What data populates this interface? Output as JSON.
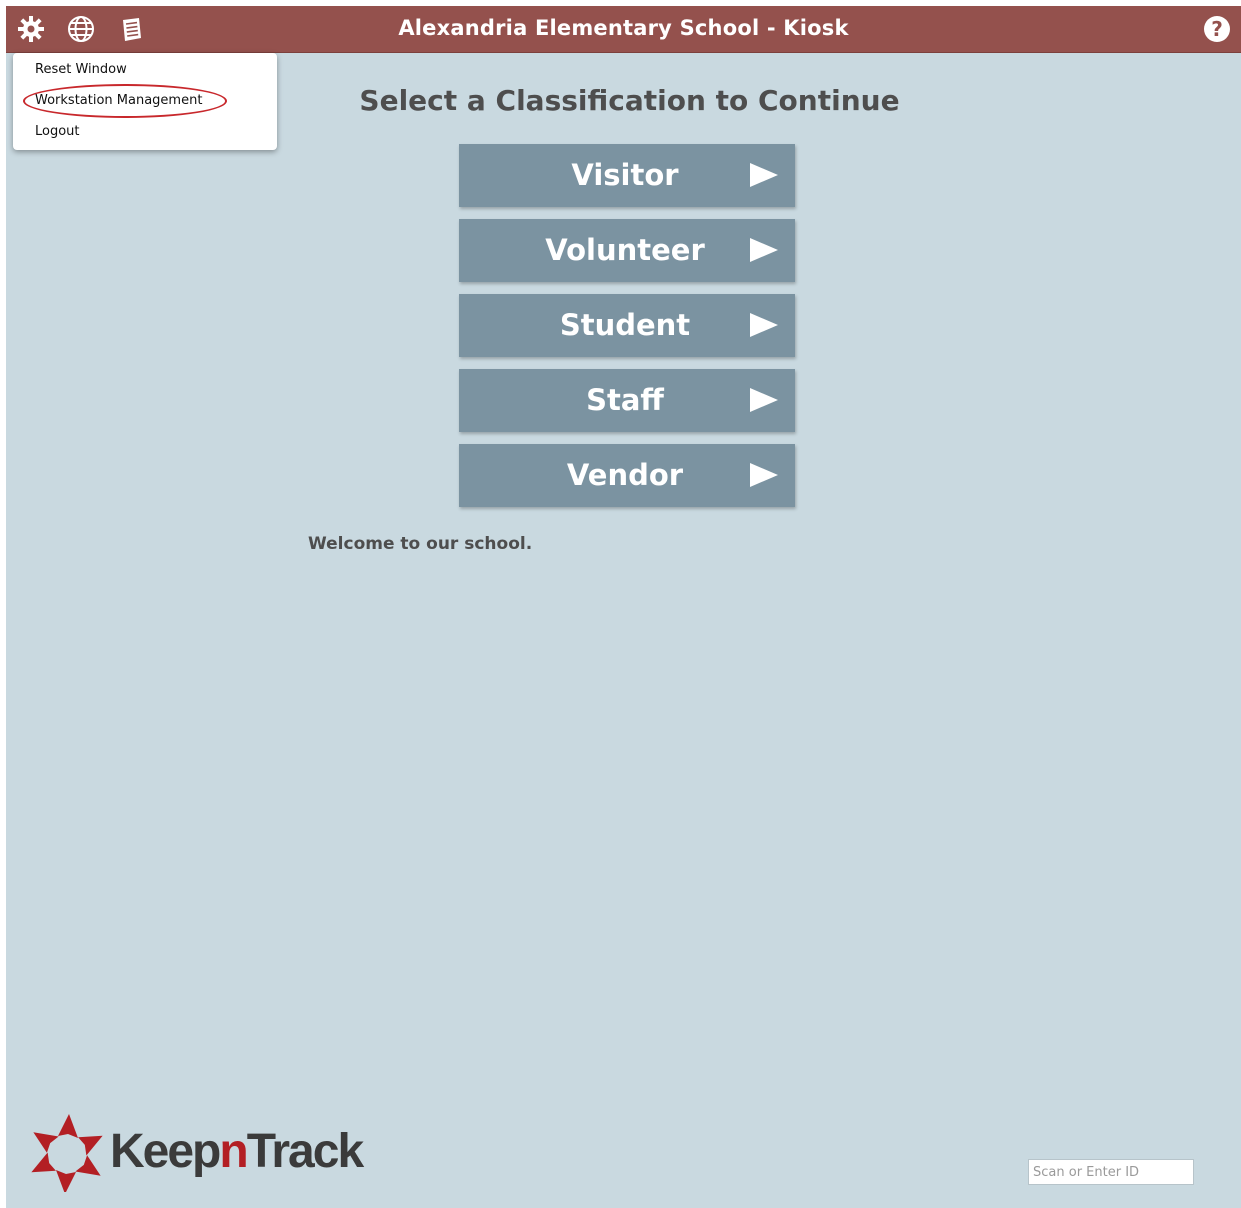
{
  "header": {
    "title": "Alexandria Elementary School - Kiosk",
    "background_color": "#94514d",
    "icons": [
      "gear-icon",
      "globe-icon",
      "notes-icon",
      "help-icon"
    ]
  },
  "menu": {
    "items": [
      {
        "label": "Reset Window"
      },
      {
        "label": "Workstation Management",
        "highlighted": true
      },
      {
        "label": "Logout"
      }
    ],
    "highlight_color": "#c8282c"
  },
  "main": {
    "heading": "Select a Classification to Continue",
    "buttons": [
      {
        "label": "Visitor",
        "icon": "play-arrow-icon"
      },
      {
        "label": "Volunteer",
        "icon": "play-arrow-icon"
      },
      {
        "label": "Student",
        "icon": "play-arrow-icon"
      },
      {
        "label": "Staff",
        "icon": "play-arrow-icon"
      },
      {
        "label": "Vendor",
        "icon": "play-arrow-icon"
      }
    ],
    "button_color": "#7b93a1",
    "welcome": "Welcome to our school.",
    "background_color": "#c9d9e0"
  },
  "footer": {
    "logo": {
      "part1": "Keep",
      "part2": "n",
      "part3": "Track",
      "accent_color": "#b31f24"
    },
    "scan_input": {
      "placeholder": "Scan or Enter ID",
      "value": ""
    }
  }
}
